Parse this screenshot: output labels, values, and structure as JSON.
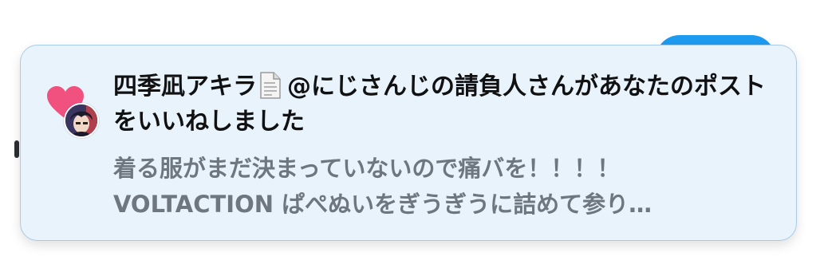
{
  "notification": {
    "type": "like",
    "username": "四季凪アキラ",
    "username_emoji": "page-facing-up",
    "mention_text": "@にじさんじの請負人さんがあなたのポストをいいねしました",
    "preview_lines": [
      "着る服がまだ決まっていないので痛バを！！！！",
      "VOLTACTION ぱぺぬいをぎうぎうに詰めて参り…"
    ]
  },
  "icons": {
    "heart": "heart-icon",
    "avatar": "user-avatar",
    "emoji": "page-facing-up-emoji"
  },
  "colors": {
    "card_background": "#e8f3fc",
    "card_border": "#a9cbe6",
    "heart": "#f0517e",
    "headline_text": "#111111",
    "preview_text": "#6e7780",
    "accent_blue": "#1d9bf0"
  }
}
